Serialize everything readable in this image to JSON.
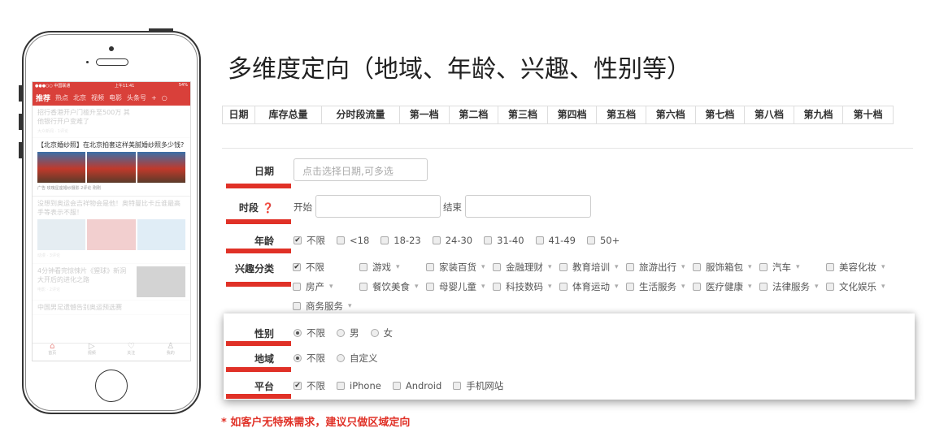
{
  "phone": {
    "status": {
      "carrier": "●●●○○ 中国联通",
      "time": "上午11:41",
      "battery": "54%"
    },
    "nav": [
      "推荐",
      "热点",
      "北京",
      "视频",
      "电影",
      "头条号"
    ],
    "news": [
      {
        "title": "招行香港开户门槛升至500万 其他银行开户变难了",
        "meta": "大众新闻 · 1评论"
      },
      {
        "title": "【北京婚纱照】在北京拍套这样美腻婚纱照多少钱?",
        "meta": "广告 玫瑰星座婚纱摄影 2评论 刚刚"
      },
      {
        "title": "没想到奥运会吉祥物会是他！奥特曼比卡丘谁最高手等表示不服！",
        "meta": "动漫 · 3评论"
      },
      {
        "title": "4分钟看完惊悚片《猩球》新洞大开后的进化之路",
        "meta": "电影 · 2评论"
      },
      {
        "title": "中国男足遗憾告别奥运预选赛",
        "meta": ""
      }
    ],
    "tabs": [
      "首页",
      "视频",
      "关注",
      "我的"
    ]
  },
  "title": "多维度定向（地域、年龄、兴趣、性别等）",
  "table_headers": [
    "日期",
    "库存总量",
    "分时段流量",
    "第一档",
    "第二档",
    "第三档",
    "第四档",
    "第五档",
    "第六档",
    "第七档",
    "第八档",
    "第九档",
    "第十档"
  ],
  "form": {
    "date": {
      "label": "日期",
      "placeholder": "点击选择日期,可多选"
    },
    "period": {
      "label": "时段",
      "start": "开始",
      "end": "结束"
    },
    "age": {
      "label": "年龄",
      "options": [
        "不限",
        "<18",
        "18-23",
        "24-30",
        "31-40",
        "41-49",
        "50+"
      ],
      "checked": [
        0
      ]
    },
    "interest": {
      "label": "兴趣分类",
      "options": [
        "不限",
        "游戏",
        "家装百货",
        "金融理财",
        "教育培训",
        "旅游出行",
        "服饰箱包",
        "汽车",
        "美容化妆",
        "房产",
        "餐饮美食",
        "母婴儿童",
        "科技数码",
        "体育运动",
        "生活服务",
        "医疗健康",
        "法律服务",
        "文化娱乐",
        "商务服务"
      ]
    },
    "gender": {
      "label": "性别",
      "options": [
        "不限",
        "男",
        "女"
      ]
    },
    "region": {
      "label": "地域",
      "options": [
        "不限",
        "自定义"
      ]
    },
    "platform": {
      "label": "平台",
      "options": [
        "不限",
        "iPhone",
        "Android",
        "手机网站"
      ]
    }
  },
  "note": "* 如客户无特殊需求，建议只做区域定向",
  "colors": {
    "accent": "#e03127",
    "app_red": "#d9403a"
  }
}
